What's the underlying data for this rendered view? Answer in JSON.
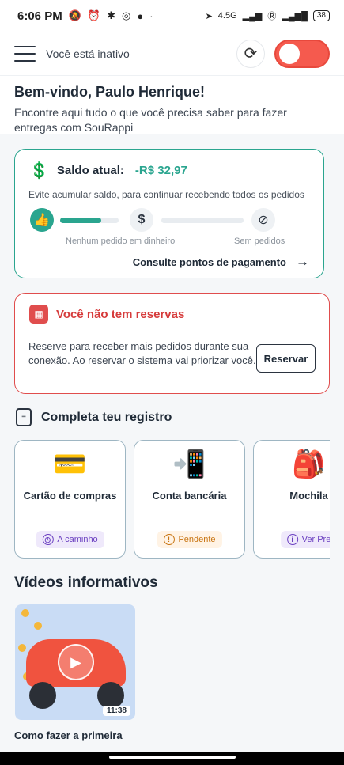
{
  "status_bar": {
    "time": "6:06 PM",
    "network": "4.5G",
    "battery": "38"
  },
  "header": {
    "status_text": "Você está inativo"
  },
  "welcome": {
    "title": "Bem-vindo, Paulo Henrique!",
    "subtitle": "Encontre aqui tudo o que você precisa saber para fazer entregas com SouRappi"
  },
  "balance": {
    "label": "Saldo atual:",
    "value": "-R$ 32,97",
    "hint": "Evite acumular saldo, para continuar recebendo todos os pedidos",
    "progress_step1": 0.7,
    "progress_step2": 0,
    "caption_1": "Nenhum pedido em dinheiro",
    "caption_2": "Sem pedidos",
    "link": "Consulte pontos de pagamento",
    "accent_color": "#2aa58f"
  },
  "reservations": {
    "title": "Você não tem reservas",
    "text": "Reserve para receber mais pedidos durante sua conexão. Ao reservar o sistema vai priorizar você.",
    "button": "Reservar",
    "accent_color": "#e04d4d"
  },
  "registration": {
    "title": "Completa teu registro",
    "cards": [
      {
        "label": "Cartão de compras",
        "badge": "A caminho",
        "icon": "credit-card-icon"
      },
      {
        "label": "Conta bancária",
        "badge": "Pendente",
        "icon": "phone-payment-icon"
      },
      {
        "label": "Mochila",
        "badge": "Ver Pre",
        "icon": "backpack-icon"
      }
    ]
  },
  "videos": {
    "title": "Vídeos informativos",
    "items": [
      {
        "title": "Como fazer a primeira",
        "duration": "11:38"
      }
    ]
  }
}
